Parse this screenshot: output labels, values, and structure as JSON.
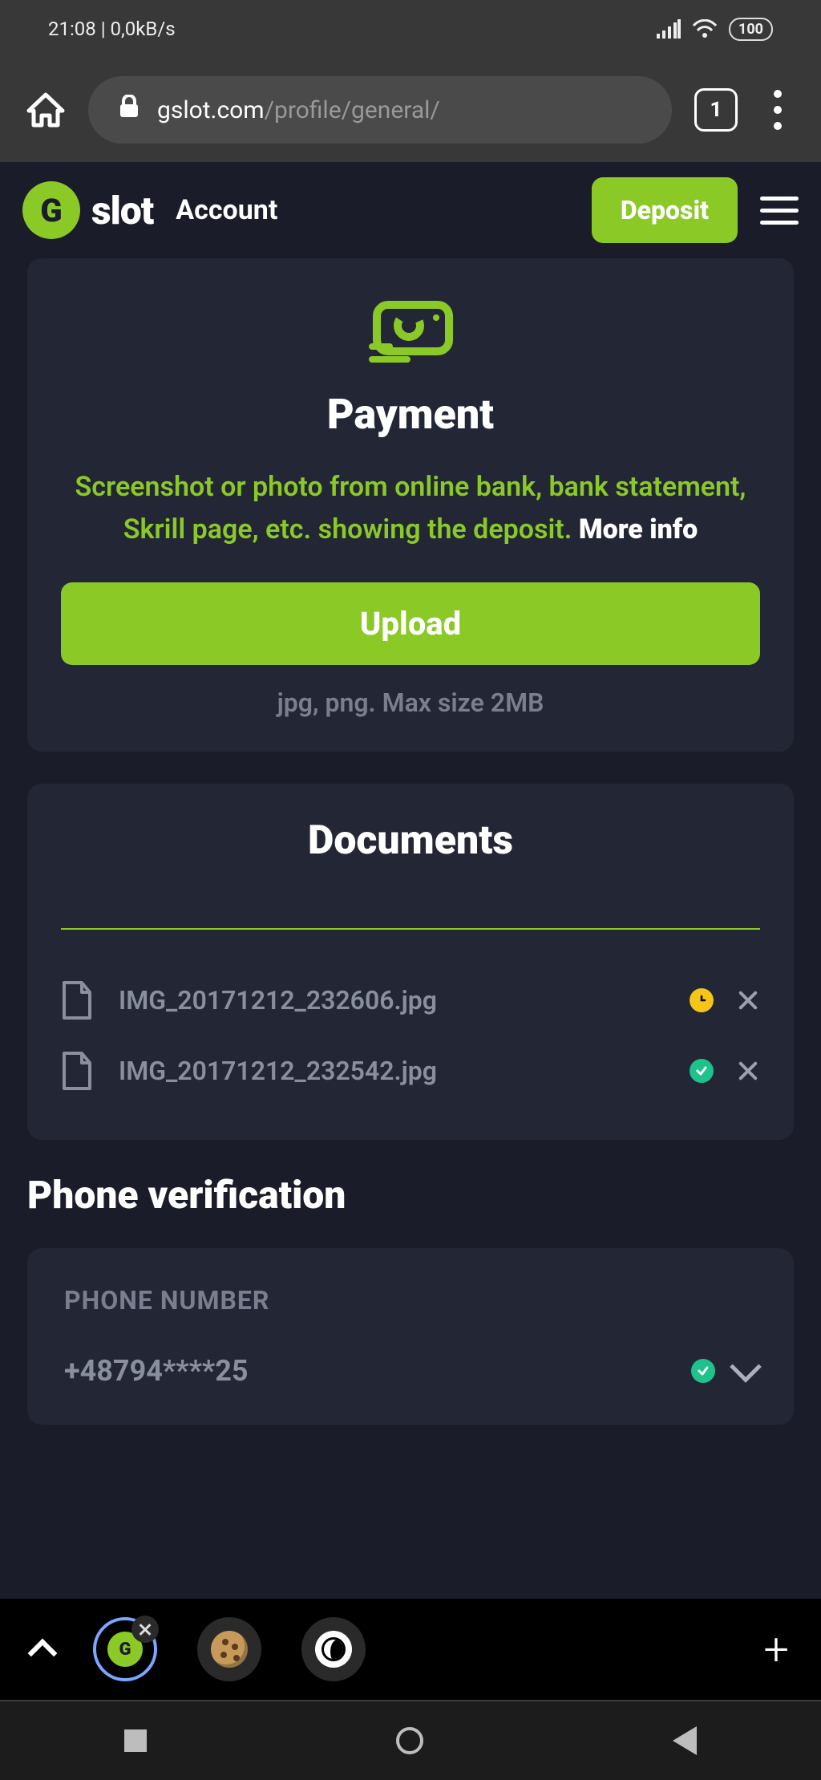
{
  "status": {
    "time_rate": "21:08 | 0,0kB/s",
    "battery": "100"
  },
  "browser": {
    "host": "gslot.com",
    "path": "/profile/general/",
    "tab_count": "1"
  },
  "header": {
    "logo_text": "slot",
    "logo_badge": "G",
    "page_name": "Account",
    "deposit": "Deposit"
  },
  "payment": {
    "title": "Payment",
    "desc": "Screenshot or photo from online bank, bank statement, Skrill page, etc. showing the deposit. ",
    "more": "More info",
    "upload": "Upload",
    "hint": "jpg, png. Max size 2MB"
  },
  "documents": {
    "title": "Documents",
    "rows": [
      {
        "name": "IMG_20171212_232606.jpg",
        "status": "pending"
      },
      {
        "name": "IMG_20171212_232542.jpg",
        "status": "ok"
      }
    ]
  },
  "phone": {
    "section": "Phone verification",
    "label": "PHONE NUMBER",
    "value": "+48794****25"
  },
  "tabbar": {
    "mini": "G"
  }
}
